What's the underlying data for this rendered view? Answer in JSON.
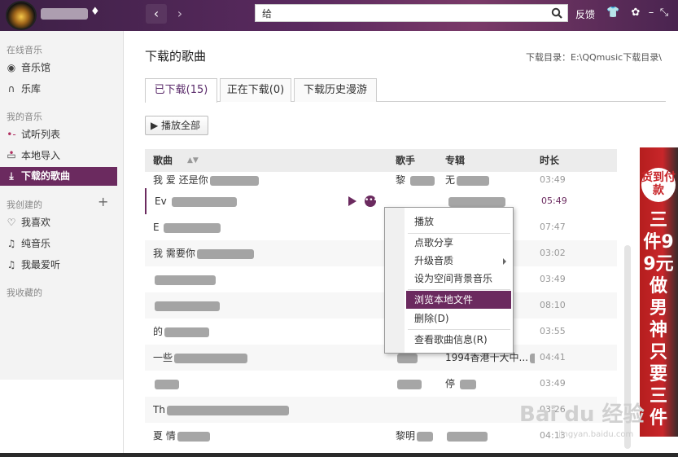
{
  "header": {
    "search_value": "给",
    "feedback_label": "反馈",
    "nav_back": "‹",
    "nav_forward": "›"
  },
  "sidebar": {
    "sections": {
      "online": "在线音乐",
      "mine": "我的音乐",
      "created": "我创建的",
      "collected": "我收藏的"
    },
    "items": [
      {
        "label": "音乐馆",
        "icon": "music-hall-icon"
      },
      {
        "label": "乐库",
        "icon": "headphones-icon"
      },
      {
        "label": "试听列表",
        "icon": "playlist-icon"
      },
      {
        "label": "本地导入",
        "icon": "monitor-icon"
      },
      {
        "label": "下载的歌曲",
        "icon": "download-icon",
        "active": true
      },
      {
        "label": "我喜欢",
        "icon": "heart-icon"
      },
      {
        "label": "纯音乐",
        "icon": "note-icon"
      },
      {
        "label": "我最爱听",
        "icon": "note-icon"
      }
    ],
    "add_label": "+"
  },
  "main": {
    "title": "下载的歌曲",
    "download_dir": "下载目录：E:\\QQmusic下载目录\\",
    "tabs": [
      {
        "label": "已下载(15)",
        "active": true
      },
      {
        "label": "正在下载(0)"
      },
      {
        "label": "下载历史漫游"
      }
    ],
    "play_all_label": "▶ 播放全部",
    "table": {
      "headers": {
        "song": "歌曲",
        "artist": "歌手",
        "album": "专辑",
        "duration": "时长"
      },
      "rows": [
        {
          "song": "我 爱 还是你",
          "artist": "黎 ",
          "album": "无",
          "duration": "03:49"
        },
        {
          "song": "Ev    ",
          "artist": "",
          "album": "",
          "duration": "05:49"
        },
        {
          "song": "E   ",
          "artist": "",
          "album": "",
          "duration": "07:47"
        },
        {
          "song": "我   需要你",
          "artist": "",
          "album": "",
          "duration": "03:02"
        },
        {
          "song": "",
          "artist": "",
          "album": "",
          "duration": "03:49"
        },
        {
          "song": "",
          "artist": "",
          "album": "",
          "duration": "08:10"
        },
        {
          "song": "   的",
          "artist": "",
          "album": "",
          "duration": "03:55"
        },
        {
          "song": "      一些",
          "artist": "",
          "album": "1994香港十大中...",
          "duration": "04:41"
        },
        {
          "song": "  ",
          "artist": "    ",
          "album": "停 ",
          "duration": "03:49"
        },
        {
          "song": "Th",
          "artist": "",
          "album": "",
          "duration": "03:26"
        },
        {
          "song": "夏 情",
          "artist": "黎明",
          "album": "",
          "duration": "04:13"
        }
      ]
    }
  },
  "context_menu": {
    "items": [
      {
        "label": "播放"
      },
      {
        "label": "点歌分享"
      },
      {
        "label": "升级音质",
        "submenu": true
      },
      {
        "label": "设为空间背景音乐"
      },
      {
        "label": "浏览本地文件",
        "highlighted": true
      },
      {
        "label": "删除(D)"
      },
      {
        "label": "查看歌曲信息(R)"
      }
    ]
  },
  "ad": {
    "badge": "货到付款",
    "text": "三件99元做男神只要三件"
  },
  "watermark": {
    "text": "Bai du 经验",
    "sub": "jingyan.baidu.com"
  },
  "colors": {
    "accent": "#6b2a5f",
    "header_bg": "#4a2450",
    "ad_red": "#c8262a"
  }
}
